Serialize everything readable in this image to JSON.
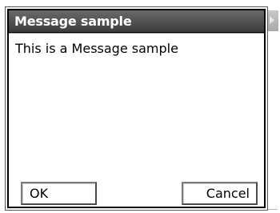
{
  "dialog": {
    "title": "Message sample",
    "message": "This is a Message sample",
    "ok_label": "OK",
    "cancel_label": "Cancel"
  },
  "colors": {
    "titlebar": "#4f4f4f",
    "title_text": "#ffffff",
    "dialog_border": "#000000",
    "button_border": "#7a7a7a"
  }
}
